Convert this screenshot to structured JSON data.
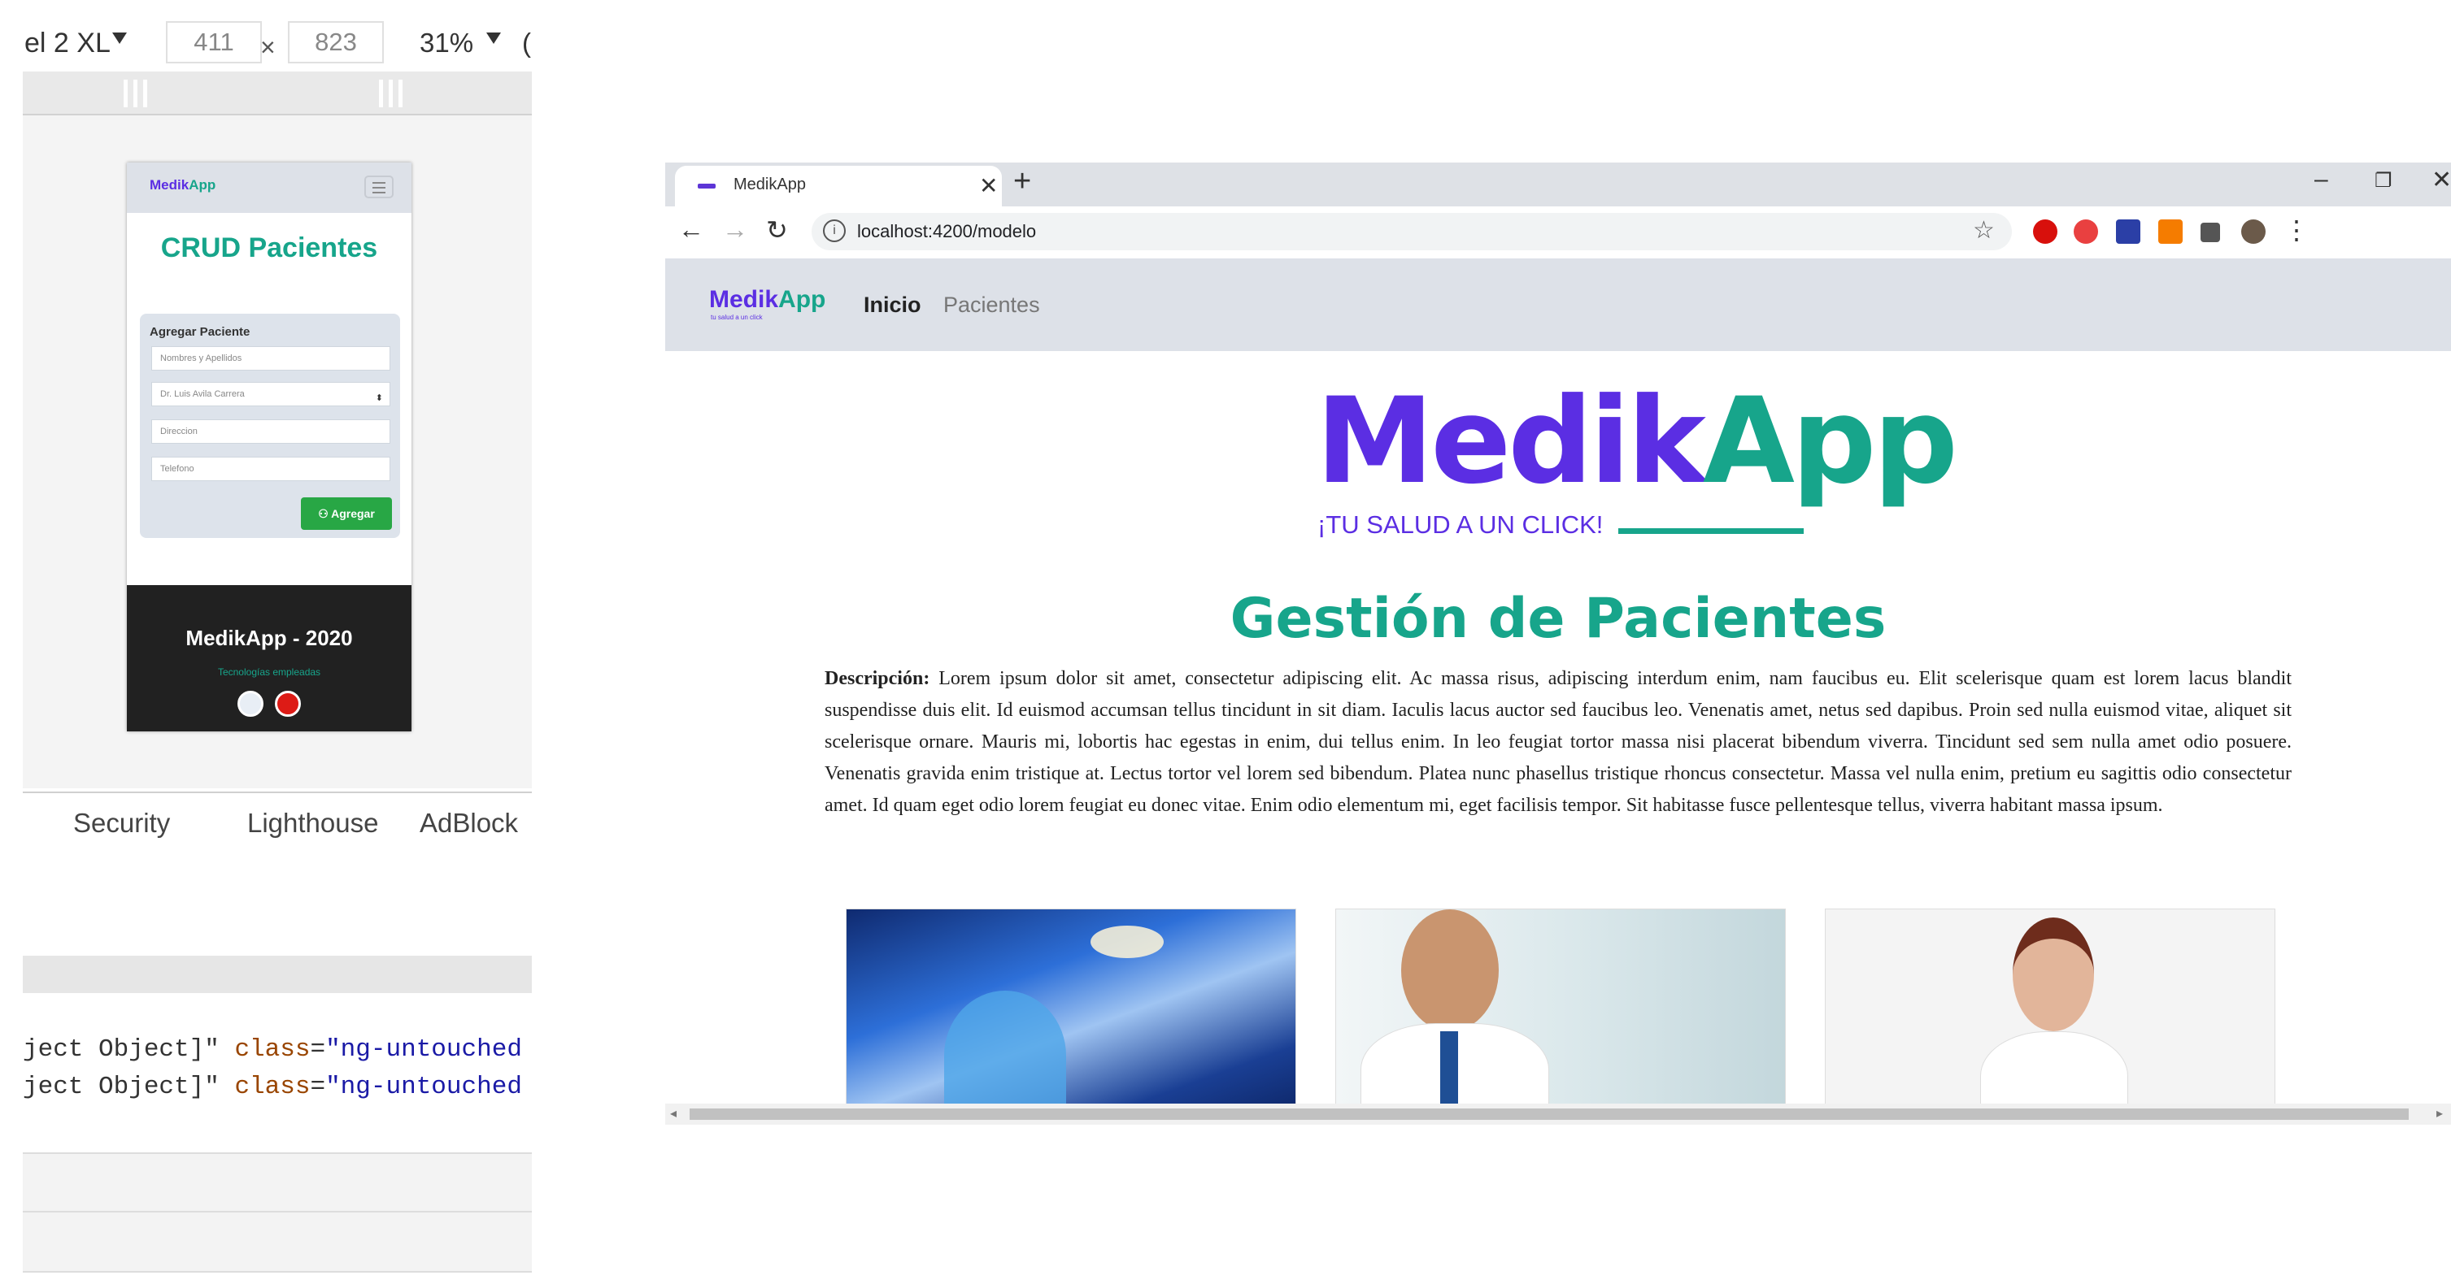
{
  "devtools": {
    "device": "el 2 XL",
    "width": "411",
    "height": "823",
    "times": "×",
    "zoom": "31%",
    "more": "(",
    "tabs": [
      "Security",
      "Lighthouse",
      "AdBlock"
    ],
    "code_lines": [
      {
        "pre": "ject Object]\" ",
        "attr": "class",
        "eq": "=",
        "val": "\"ng-untouched n"
      },
      {
        "pre": "ject Object]\" ",
        "attr": "class",
        "eq": "=",
        "val": "\"ng-untouched n"
      }
    ]
  },
  "mobile_preview": {
    "logo": "MedikApp",
    "title": "CRUD Pacientes",
    "card_title": "Agregar Paciente",
    "name_placeholder": "Nombres y Apellidos",
    "doctor_selected": "Dr. Luis Avila Carrera",
    "select_arrow": "⬍",
    "address_placeholder": "Direccion",
    "phone_placeholder": "Telefono",
    "add_button": "Agregar",
    "footer_title": "MedikApp - 2020",
    "footer_sub": "Tecnologías empleadas"
  },
  "browser": {
    "tab_title": "MedikApp",
    "close_glyph": "✕",
    "new_tab_glyph": "+",
    "minimize": "–",
    "restore": "❐",
    "close_window": "✕",
    "url": "localhost:4200/modelo",
    "info_glyph": "i",
    "star_glyph": "☆",
    "back_glyph": "←",
    "forward_glyph": "→",
    "reload_glyph": "↻",
    "menu_glyph": "⋮"
  },
  "site": {
    "logo_part1": "Medik",
    "logo_part2": "App",
    "logo_tagline": "tu salud a un click",
    "nav": [
      {
        "label": "Inicio",
        "active": true
      },
      {
        "label": "Pacientes",
        "active": false
      }
    ],
    "hero_part1": "Medik",
    "hero_part2": "App",
    "slogan": "¡TU SALUD A UN CLICK!",
    "page_title": "Gestión de Pacientes",
    "desc_label": "Descripción:",
    "desc_text": "Lorem ipsum dolor sit amet, consectetur adipiscing elit. Ac massa risus, adipiscing interdum enim, nam faucibus eu. Elit scelerisque quam est lorem lacus blandit suspendisse duis elit. Id euismod accumsan tellus tincidunt in sit diam. Iaculis lacus auctor sed faucibus leo. Venenatis amet, netus sed dapibus. Proin sed nulla euismod vitae, aliquet sit scelerisque ornare. Mauris mi, lobortis hac egestas in enim, dui tellus enim. In leo feugiat tortor massa nisi placerat bibendum viverra. Tincidunt sed sem nulla amet odio posuere. Venenatis gravida enim tristique at. Lectus tortor vel lorem sed bibendum. Platea nunc phasellus tristique rhoncus consectetur. Massa vel nulla enim, pretium eu sagittis odio consectetur amet. Id quam eget odio lorem feugiat eu donec vitae. Enim odio elementum mi, eget facilisis tempor. Sit habitasse fusce pellentesque tellus, viverra habitant massa ipsum."
  },
  "colors": {
    "brand_purple": "#5b2ee3",
    "brand_teal": "#17a58b",
    "nav_bg": "#dde1e8",
    "success": "#28a745"
  }
}
